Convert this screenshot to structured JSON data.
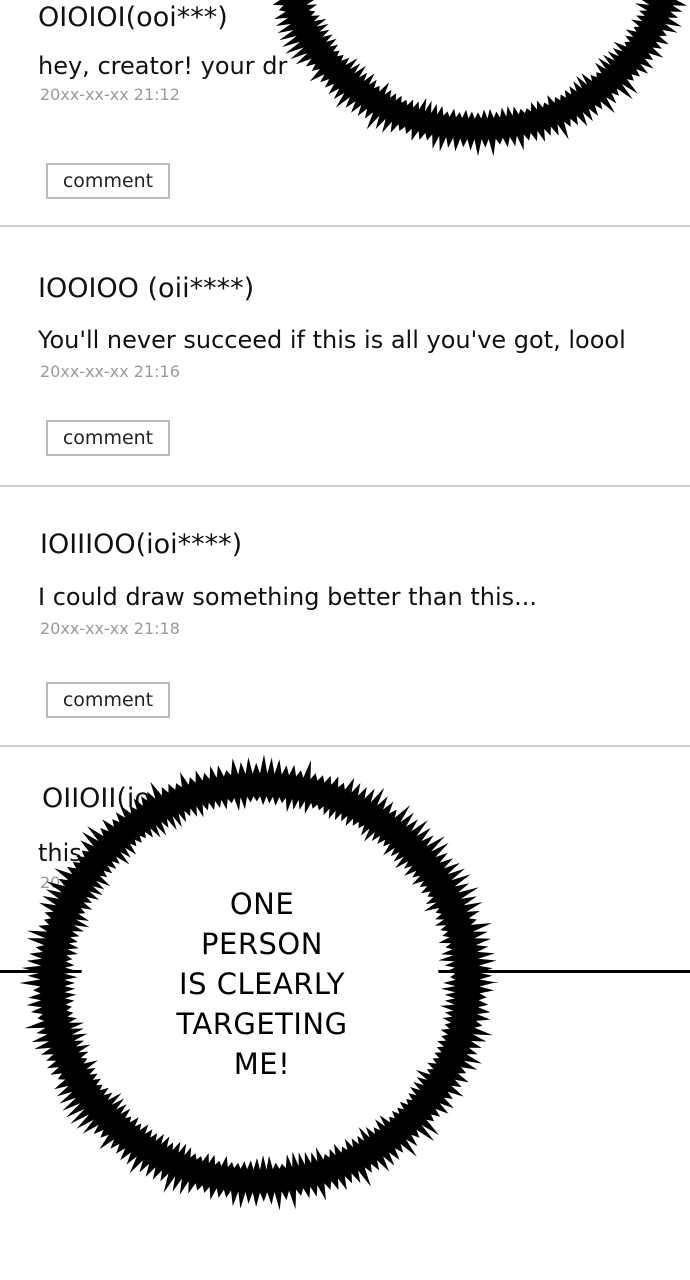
{
  "comments": [
    {
      "username": "OIOIOI(ooi***)",
      "text": "hey, creator! your dr",
      "timestamp": "20xx-xx-xx 21:12",
      "button": "comment"
    },
    {
      "username": "IOOIOO (oii****)",
      "text": "You'll never succeed if this is all you've got, loool",
      "timestamp": "20xx-xx-xx 21:16",
      "button": "comment"
    },
    {
      "username": "IOIIIOO(ioi****)",
      "text": "I could draw something better than this...",
      "timestamp": "20xx-xx-xx 21:18",
      "button": "comment"
    },
    {
      "username": "OIIOII(io",
      "text": "this",
      "timestamp": "20x"
    }
  ],
  "speech_bubble": {
    "lines": [
      "ONE",
      "PERSON",
      "IS CLEARLY",
      "TARGETING",
      "ME!"
    ]
  },
  "colors": {
    "background": "#ffffff",
    "ink": "#000000",
    "timestamp": "#9a9a9a",
    "divider": "#cfcfcf"
  }
}
